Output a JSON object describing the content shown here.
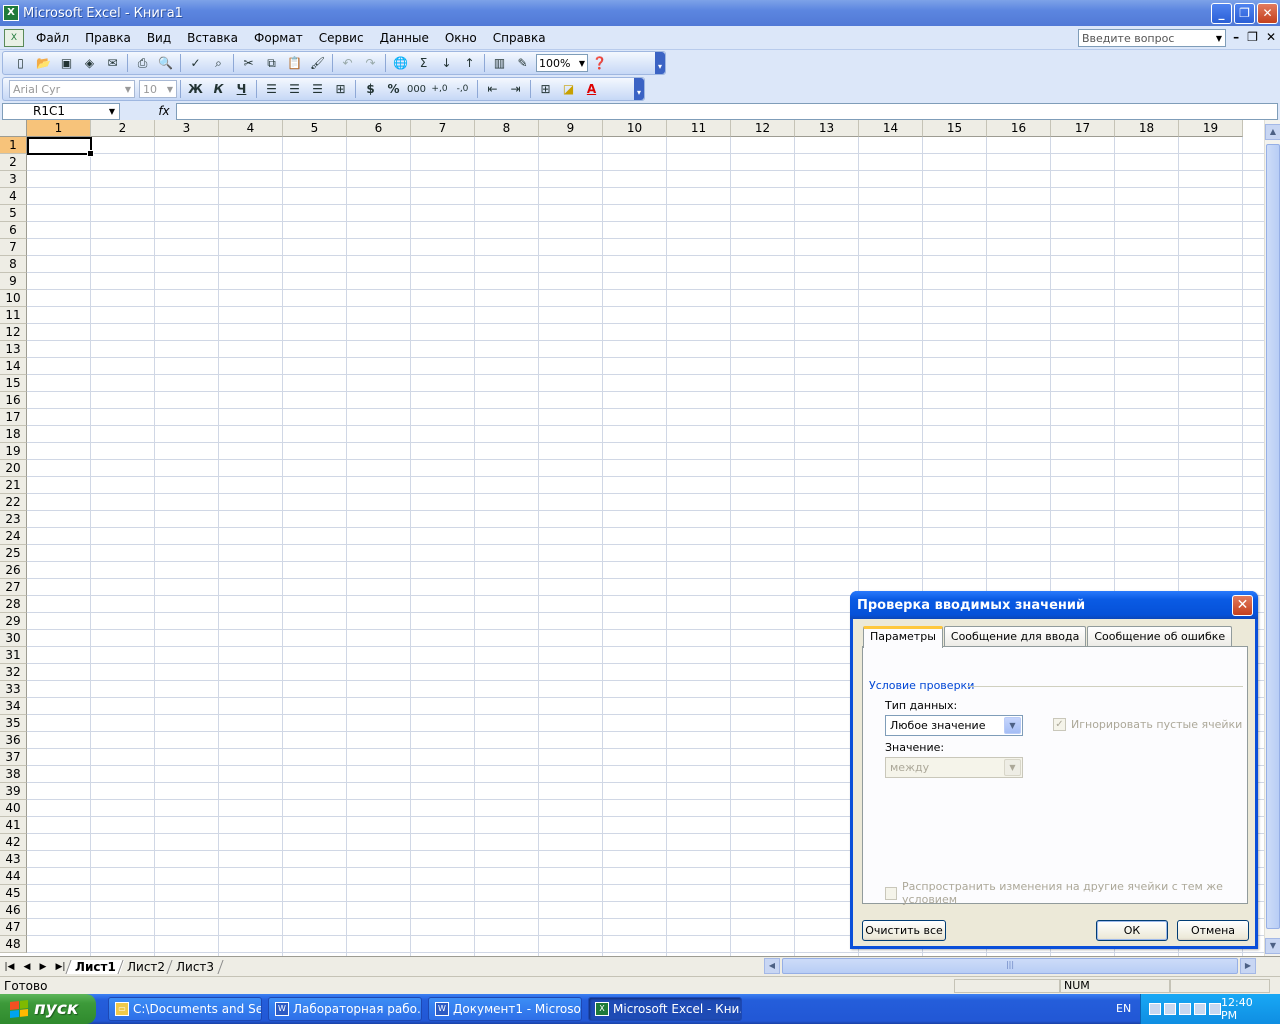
{
  "window": {
    "title": "Microsoft Excel - Книга1",
    "app_icon": "excel-icon",
    "controls": [
      "_",
      "❐",
      "✕"
    ]
  },
  "menu": {
    "items": [
      "Файл",
      "Правка",
      "Вид",
      "Вставка",
      "Формат",
      "Сервис",
      "Данные",
      "Окно",
      "Справка"
    ],
    "ask_placeholder": "Введите вопрос",
    "mdi_controls": [
      "–",
      "❐",
      "✕"
    ]
  },
  "toolbar": {
    "zoom": "100%",
    "font": "Arial Cyr",
    "size": "10",
    "bold": "Ж",
    "italic": "К",
    "underline": "Ч",
    "currency": "$",
    "percent": "%",
    "thousands": "000"
  },
  "formula_bar": {
    "name_box": "R1C1",
    "fx": "fx",
    "value": ""
  },
  "grid": {
    "columns": [
      "1",
      "2",
      "3",
      "4",
      "5",
      "6",
      "7",
      "8",
      "9",
      "10",
      "11",
      "12",
      "13",
      "14",
      "15",
      "16",
      "17",
      "18",
      "19"
    ],
    "rows": [
      "1",
      "2",
      "3",
      "4",
      "5",
      "6",
      "7",
      "8",
      "9",
      "10",
      "11",
      "12",
      "13",
      "14",
      "15",
      "16",
      "17",
      "18",
      "19",
      "20",
      "21",
      "22",
      "23",
      "24",
      "25",
      "26",
      "27",
      "28",
      "29",
      "30",
      "31",
      "32",
      "33",
      "34",
      "35",
      "36",
      "37",
      "38",
      "39",
      "40",
      "41",
      "42",
      "43",
      "44",
      "45",
      "46",
      "47",
      "48"
    ],
    "active_cell": "R1C1"
  },
  "sheets": {
    "tabs": [
      "Лист1",
      "Лист2",
      "Лист3"
    ],
    "active": "Лист1"
  },
  "status": {
    "ready": "Готово",
    "num": "NUM"
  },
  "dialog": {
    "title": "Проверка вводимых значений",
    "tabs": [
      "Параметры",
      "Сообщение для ввода",
      "Сообщение об ошибке"
    ],
    "active_tab": "Параметры",
    "group_label": "Условие проверки",
    "data_type_label": "Тип данных:",
    "data_type_value": "Любое значение",
    "ignore_blank_label": "Игнорировать пустые ячейки",
    "ignore_blank_checked": true,
    "value_label": "Значение:",
    "value_value": "между",
    "apply_all_label": "Распространить изменения на другие ячейки с тем же условием",
    "apply_all_checked": false,
    "clear_all": "Очистить все",
    "ok": "ОК",
    "cancel": "Отмена"
  },
  "taskbar": {
    "start": "пуск",
    "tasks": [
      {
        "label": "C:\\Documents and Se...",
        "icon": "folder-icon"
      },
      {
        "label": "Лабораторная рабо...",
        "icon": "word-icon"
      },
      {
        "label": "Документ1 - Microso...",
        "icon": "word-icon"
      },
      {
        "label": "Microsoft Excel - Кни...",
        "icon": "excel-icon"
      }
    ],
    "active_task": 3,
    "lang": "EN",
    "clock": "12:40 PM"
  }
}
